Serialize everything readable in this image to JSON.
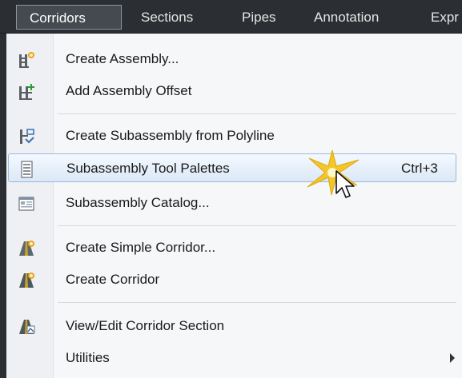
{
  "menubar": {
    "items": [
      {
        "label": "Corridors",
        "active": true
      },
      {
        "label": "Sections"
      },
      {
        "label": "Pipes"
      },
      {
        "label": "Annotation"
      },
      {
        "label": "Expr"
      }
    ]
  },
  "menu": {
    "items": [
      {
        "label": "Create Assembly...",
        "icon": "create-assembly-icon"
      },
      {
        "label": "Add Assembly Offset",
        "icon": "add-assembly-offset-icon"
      },
      {
        "label": "Create Subassembly from Polyline",
        "icon": "create-subassembly-polyline-icon"
      },
      {
        "label": "Subassembly Tool Palettes",
        "icon": "tool-palettes-icon",
        "shortcut": "Ctrl+3",
        "highlighted": true
      },
      {
        "label": "Subassembly Catalog...",
        "icon": "catalog-icon"
      },
      {
        "label": "Create Simple Corridor...",
        "icon": "simple-corridor-icon"
      },
      {
        "label": "Create Corridor",
        "icon": "corridor-icon"
      },
      {
        "label": "View/Edit Corridor Section",
        "icon": "corridor-section-icon"
      },
      {
        "label": "Utilities",
        "submenu": true
      }
    ]
  },
  "colors": {
    "menubar_bg": "#2b2f33",
    "highlight_border": "#9ab8de",
    "highlight_bg": "#dbe8f6",
    "menu_bg": "#f6f7f9"
  }
}
